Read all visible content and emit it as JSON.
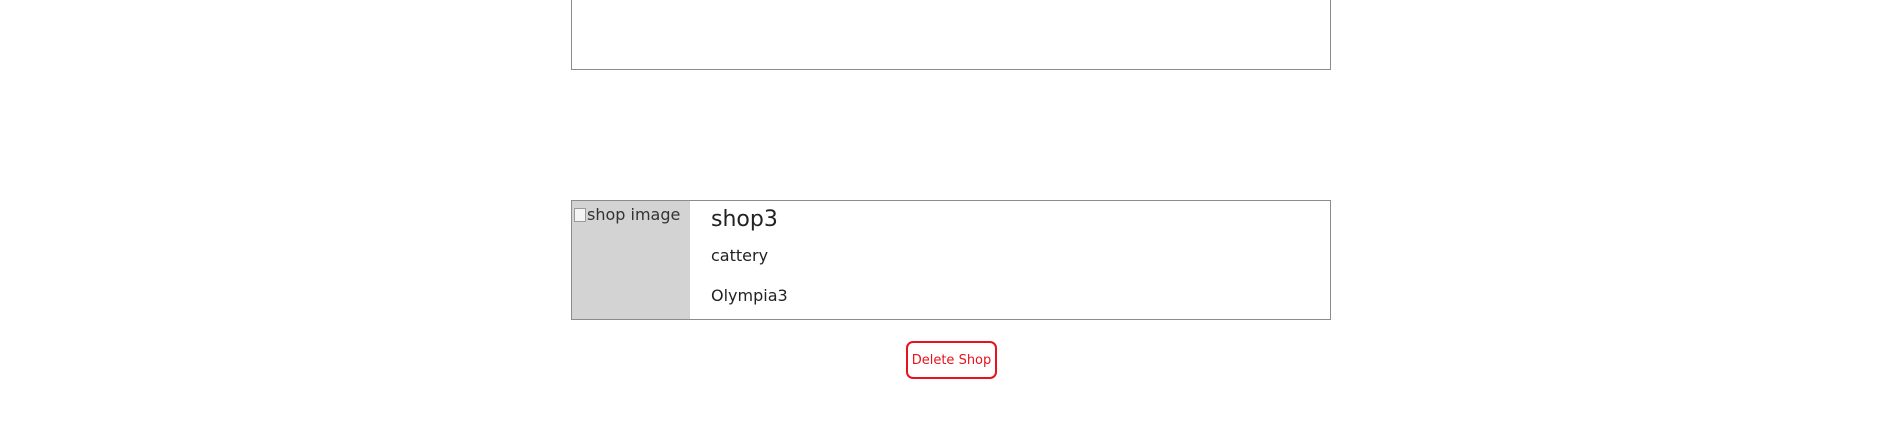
{
  "shop": {
    "image_alt": "shop image",
    "name": "shop3",
    "category": "cattery",
    "owner": "Olympia3"
  },
  "actions": {
    "delete_label": "Delete Shop"
  },
  "colors": {
    "danger": "#e8121c",
    "image_placeholder": "#d3d3d3",
    "border": "#8c8c8c"
  }
}
